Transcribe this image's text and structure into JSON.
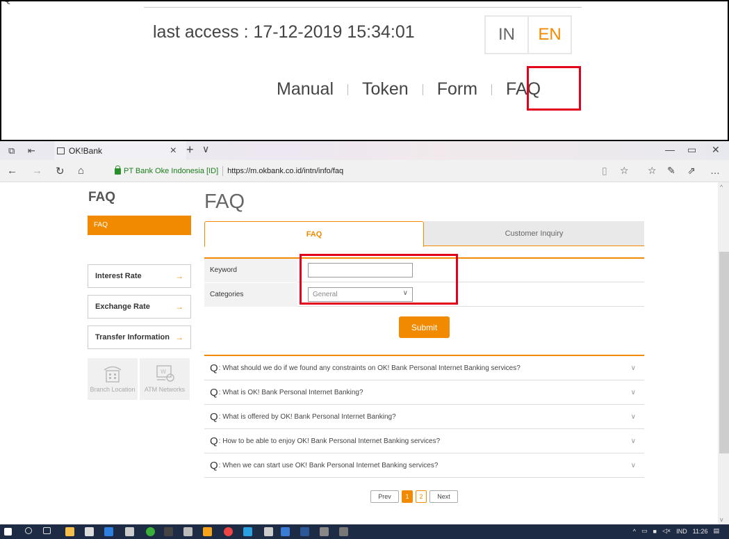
{
  "top_panel": {
    "last_access": "last access : 17-12-2019 15:34:01",
    "lang_in": "IN",
    "lang_en": "EN",
    "nav": [
      "Manual",
      "Token",
      "Form",
      "FAQ"
    ]
  },
  "browser": {
    "tab_title": "OK!Bank",
    "site_identity": "PT Bank Oke Indonesia [ID]",
    "url": "https://m.okbank.co.id/intn/info/faq"
  },
  "sidebar": {
    "title": "FAQ",
    "active_item": "FAQ",
    "links": [
      "Interest Rate",
      "Exchange Rate",
      "Transfer Information"
    ],
    "tiles": [
      "Branch Location",
      "ATM Networks"
    ]
  },
  "main": {
    "title": "FAQ",
    "tabs": [
      "FAQ",
      "Customer Inquiry"
    ],
    "form": {
      "keyword_label": "Keyword",
      "keyword_value": "",
      "categories_label": "Categories",
      "categories_selected": "General",
      "submit_label": "Submit"
    },
    "faq_q_prefix": "Q",
    "faqs": [
      ": What should we do if we found any constraints on OK! Bank Personal Internet Banking services?",
      ": What is OK! Bank Personal Internet Banking?",
      ": What is offered by OK! Bank Personal Internet Banking?",
      ": How to be able to enjoy OK! Bank Personal Internet Banking services?",
      ": When we can start use OK! Bank Personal Internet Banking services?"
    ],
    "pagination": {
      "prev": "Prev",
      "pages": [
        "1",
        "2"
      ],
      "next": "Next",
      "current": "1"
    }
  },
  "taskbar": {
    "language": "IND",
    "time": "11:26"
  },
  "colors": {
    "accent": "#f28a00",
    "highlight": "#e3001b",
    "taskbar": "#1e2b44"
  }
}
